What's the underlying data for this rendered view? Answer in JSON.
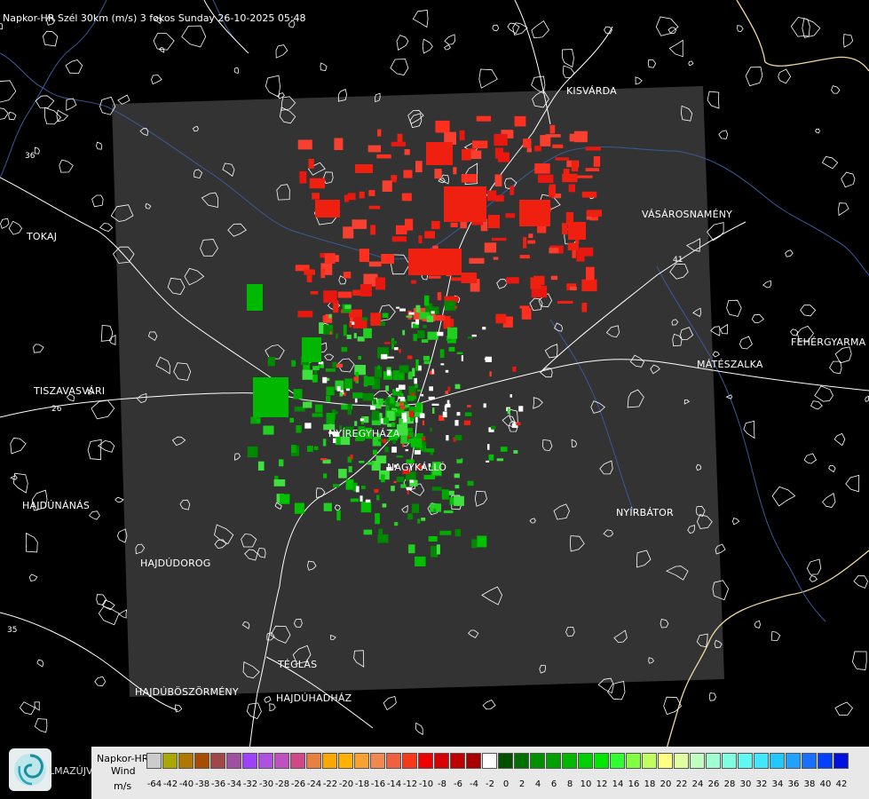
{
  "title": "Napkor-HR Szél 30km (m/s) 3 fokos Sunday 26-10-2025 05:48",
  "cities": [
    {
      "id": "kisvarda",
      "name": "KISVÁRDA"
    },
    {
      "id": "tokaj",
      "name": "TOKAJ"
    },
    {
      "id": "vasarosnameny",
      "name": "VÁSÁROSNAMÉNY"
    },
    {
      "id": "fehergyarmat",
      "name": "FEHÉRGYARMA"
    },
    {
      "id": "mateszalka",
      "name": "MÁTÉSZALKA"
    },
    {
      "id": "tiszavasvari",
      "name": "TISZAVASVÁRI"
    },
    {
      "id": "nyiregyhaza",
      "name": "NYÍREGYHÁZA"
    },
    {
      "id": "nagykallo",
      "name": "NAGYKÁLLÓ"
    },
    {
      "id": "nyirbator",
      "name": "NYÍRBÁTOR"
    },
    {
      "id": "hajdunanas",
      "name": "HAJDÚNÁNÁS"
    },
    {
      "id": "hajdudorog",
      "name": "HAJDÚDOROG"
    },
    {
      "id": "teglas",
      "name": "TÉGLÁS"
    },
    {
      "id": "hajduboszormeny",
      "name": "HAJDÚBÖSZÖRMÉNY"
    },
    {
      "id": "hajduhadhaz",
      "name": "HAJDÚHADHÁZ"
    }
  ],
  "road_numbers": [
    "36",
    "41",
    "26",
    "35"
  ],
  "logo_text": "LMAZÚJVÁR",
  "legend": {
    "line1": "Napkor-HR",
    "line2": "Wind",
    "line3": "m/s",
    "values": [
      "-64",
      "-42",
      "-40",
      "-38",
      "-36",
      "-34",
      "-32",
      "-30",
      "-28",
      "-26",
      "-24",
      "-22",
      "-20",
      "-18",
      "-16",
      "-14",
      "-12",
      "-10",
      "-8",
      "-6",
      "-4",
      "-2",
      "0",
      "2",
      "4",
      "6",
      "8",
      "10",
      "12",
      "14",
      "16",
      "18",
      "20",
      "22",
      "24",
      "26",
      "28",
      "30",
      "32",
      "34",
      "36",
      "38",
      "40",
      "42"
    ],
    "colors": [
      "#cccccc",
      "#a8a800",
      "#b07800",
      "#a84c00",
      "#a04848",
      "#a050a0",
      "#a040ff",
      "#b050e0",
      "#c050c0",
      "#d04888",
      "#e88040",
      "#f8a800",
      "#ffb000",
      "#f8a030",
      "#f08850",
      "#f06040",
      "#f83818",
      "#f00000",
      "#d80000",
      "#c00000",
      "#a80000",
      "#ffffff",
      "#005000",
      "#007000",
      "#009000",
      "#00a000",
      "#00b800",
      "#00d000",
      "#00e800",
      "#30ff30",
      "#80ff40",
      "#c0ff60",
      "#ffff80",
      "#e0ffa0",
      "#c0ffc0",
      "#a0ffd0",
      "#80ffe0",
      "#60f8f0",
      "#40e8ff",
      "#20c8ff",
      "#20a0ff",
      "#1870ff",
      "#0040ff",
      "#0010e0"
    ]
  },
  "colors": {
    "radar_bg": "#333333",
    "approaching": "#00c000",
    "receding": "#f02010",
    "river": "#3a5a9a",
    "border": "#f0d8a0"
  }
}
